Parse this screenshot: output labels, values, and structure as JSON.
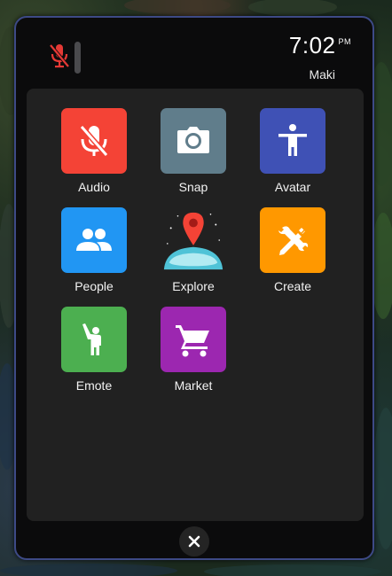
{
  "status": {
    "time": "7:02",
    "ampm": "PM",
    "user": "Maki",
    "mic_icon": "mic-off-icon",
    "mic_color": "#e53935"
  },
  "apps": [
    {
      "label": "Audio",
      "icon": "mic-off-icon",
      "color": "#f44336"
    },
    {
      "label": "Snap",
      "icon": "camera-icon",
      "color": "#607d8b"
    },
    {
      "label": "Avatar",
      "icon": "person-icon",
      "color": "#3f51b5"
    },
    {
      "label": "People",
      "icon": "people-icon",
      "color": "#2196f3"
    },
    {
      "label": "Explore",
      "icon": "map-pin-globe-icon",
      "color": "transparent"
    },
    {
      "label": "Create",
      "icon": "tools-icon",
      "color": "#ff9800"
    },
    {
      "label": "Emote",
      "icon": "wave-person-icon",
      "color": "#4caf50"
    },
    {
      "label": "Market",
      "icon": "cart-icon",
      "color": "#9c27b0"
    }
  ],
  "close": {
    "icon": "close-icon"
  }
}
